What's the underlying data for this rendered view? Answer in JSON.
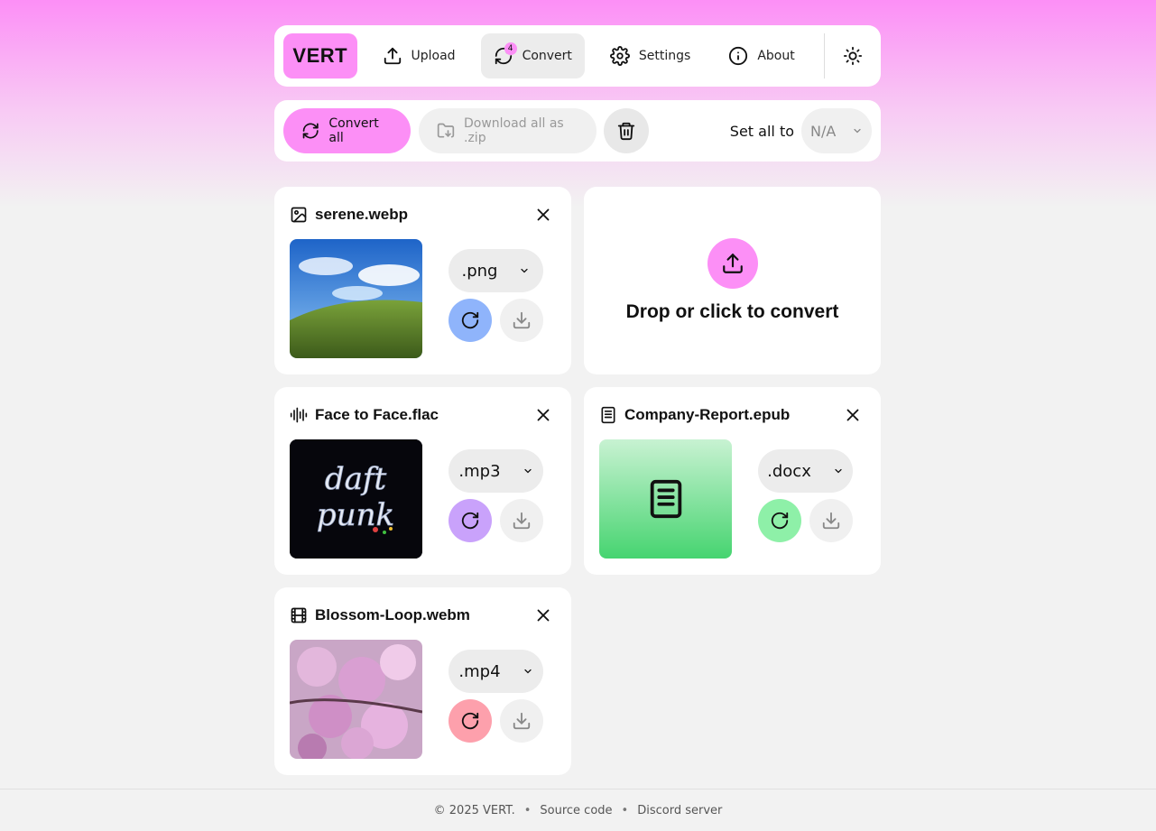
{
  "brand": {
    "logo": "VERT",
    "accent": "#fc8ff6"
  },
  "nav": {
    "upload": "Upload",
    "convert": "Convert",
    "convert_badge": "4",
    "settings": "Settings",
    "about": "About"
  },
  "toolbar": {
    "convert_all": "Convert all",
    "download_zip": "Download all as .zip",
    "set_all_to": "Set all to",
    "set_all_value": "N/A"
  },
  "files": [
    {
      "name": "serene.webp",
      "icon": "image-icon",
      "format": ".png",
      "color": "#8fb4fb"
    },
    {
      "name": "Face to Face.flac",
      "icon": "audio-wave-icon",
      "format": ".mp3",
      "color": "#c9a2fb"
    },
    {
      "name": "Company-Report.epub",
      "icon": "document-icon",
      "format": ".docx",
      "color": "#8ef0a8"
    },
    {
      "name": "Blossom-Loop.webm",
      "icon": "film-icon",
      "format": ".mp4",
      "color": "#fda0ac"
    }
  ],
  "dropzone": {
    "text": "Drop or click to convert"
  },
  "footer": {
    "copyright": "© 2025 VERT.",
    "source": "Source code",
    "discord": "Discord server"
  }
}
